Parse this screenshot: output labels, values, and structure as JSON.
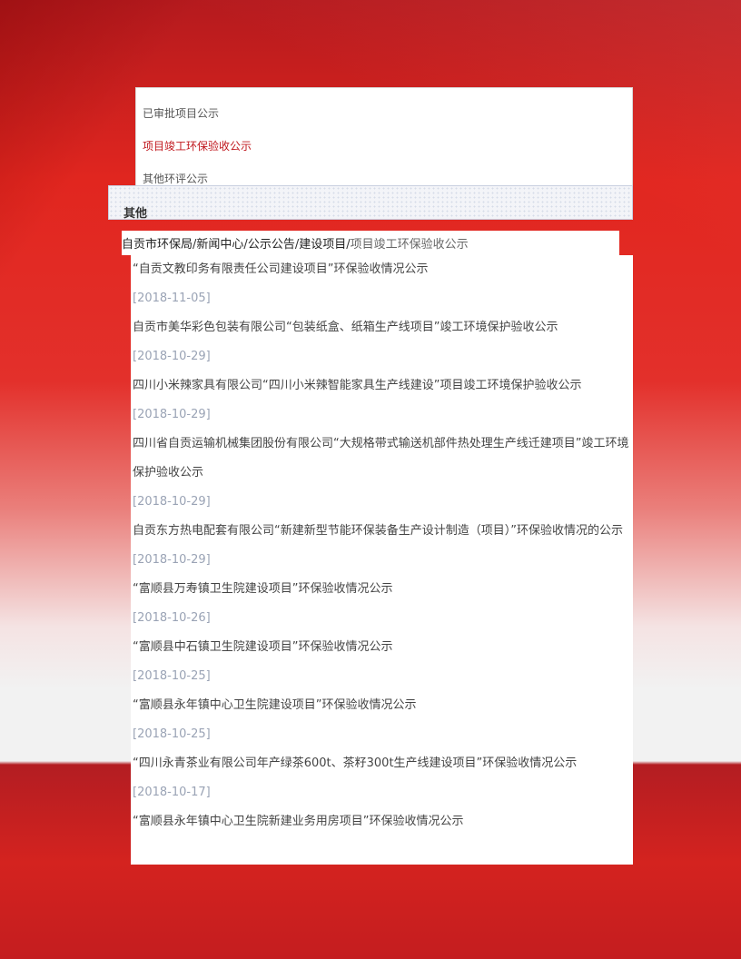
{
  "side_menu": {
    "items": [
      {
        "label": "已审批项目公示",
        "active": false
      },
      {
        "label": "项目竣工环保验收公示",
        "active": true
      },
      {
        "label": "其他环评公示",
        "active": false
      }
    ]
  },
  "category": {
    "title": "其他"
  },
  "breadcrumb": {
    "items": [
      "自贡市环保局",
      "新闻中心",
      "公示公告",
      "建设项目"
    ],
    "separator": "/",
    "current": "项目竣工环保验收公示"
  },
  "news": [
    {
      "title": "“自贡文教印务有限责任公司建设项目”环保验收情况公示",
      "date": "[2018-11-05]"
    },
    {
      "title": "自贡市美华彩色包装有限公司“包装纸盒、纸箱生产线项目”竣工环境保护验收公示",
      "date": "[2018-10-29]"
    },
    {
      "title": "四川小米辣家具有限公司“四川小米辣智能家具生产线建设”项目竣工环境保护验收公示",
      "date": "[2018-10-29]"
    },
    {
      "title": "四川省自贡运输机械集团股份有限公司“大规格带式输送机部件热处理生产线迁建项目”竣工环境保护验收公示",
      "date": "[2018-10-29]"
    },
    {
      "title": "自贡东方热电配套有限公司“新建新型节能环保装备生产设计制造（项目）”环保验收情况的公示",
      "date": "[2018-10-29]"
    },
    {
      "title": "“富顺县万寿镇卫生院建设项目”环保验收情况公示",
      "date": "[2018-10-26]"
    },
    {
      "title": "“富顺县中石镇卫生院建设项目”环保验收情况公示",
      "date": "[2018-10-25]"
    },
    {
      "title": "“富顺县永年镇中心卫生院建设项目”环保验收情况公示",
      "date": "[2018-10-25]"
    },
    {
      "title": "“四川永青茶业有限公司年产绿茶600t、茶籽300t生产线建设项目”环保验收情况公示",
      "date": "[2018-10-17]"
    },
    {
      "title": "“富顺县永年镇中心卫生院新建业务用房项目”环保验收情况公示",
      "date": ""
    }
  ]
}
